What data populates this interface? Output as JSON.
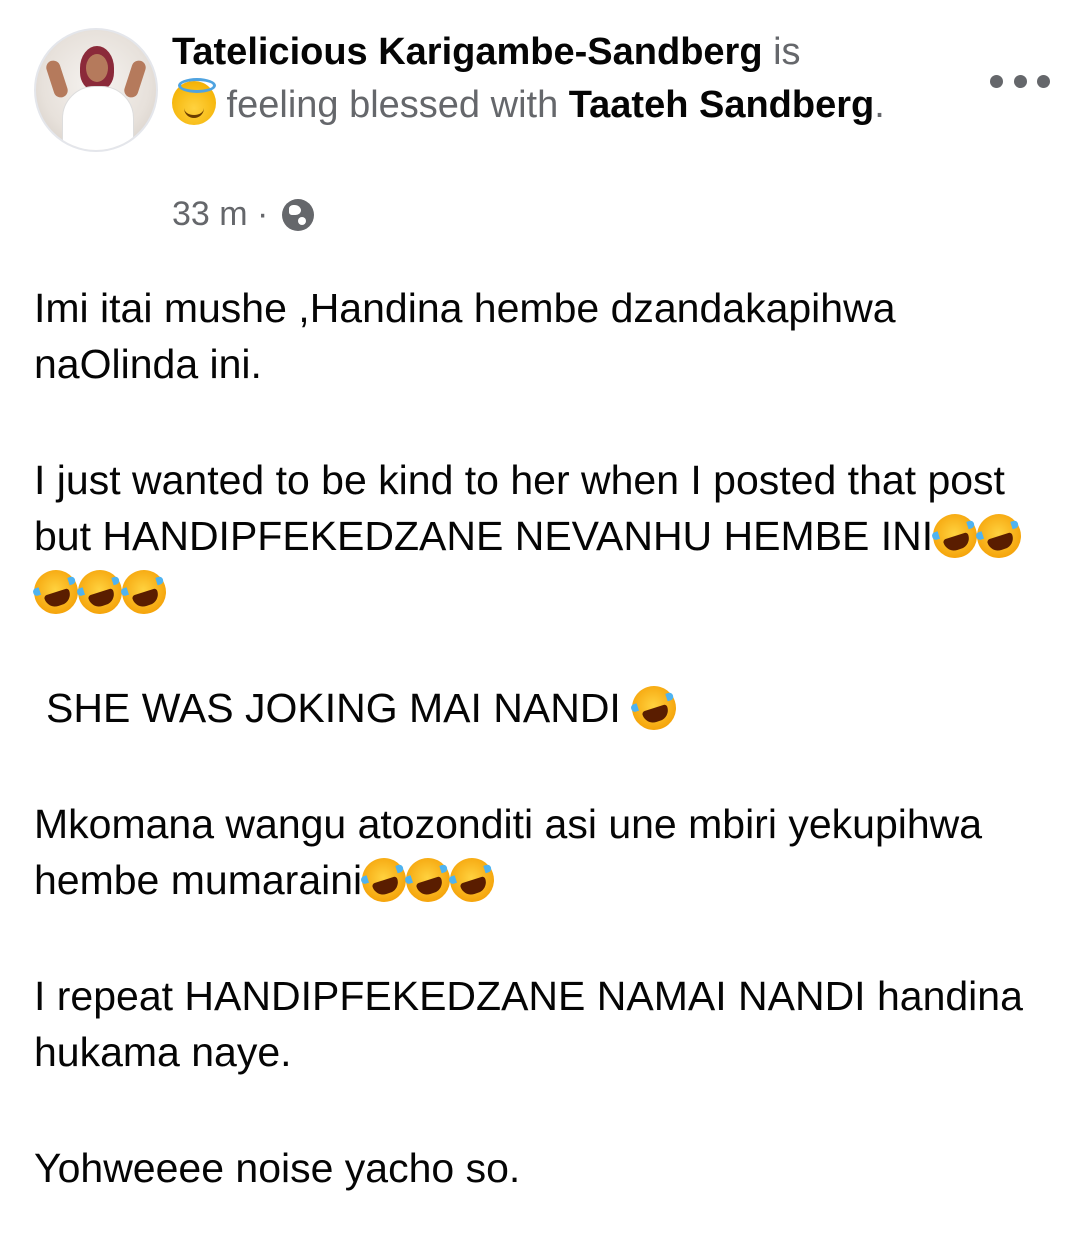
{
  "post": {
    "author": "Tatelicious Karigambe-Sandberg",
    "verb": " is",
    "feeling_text": " feeling blessed with ",
    "tagged": "Taateh Sandberg",
    "period": ".",
    "feeling_emoji": "smiling-face-with-halo-emoji",
    "time": "33 m · ",
    "privacy_icon": "globe-icon"
  },
  "body": {
    "p1": "Imi itai mushe ,Handina hembe dzandakapihwa naOlinda ini.",
    "p2": "I just wanted to be kind to her when I posted that post but HANDIPFEKEDZANE NEVANHU HEMBE INI",
    "p3": "SHE WAS JOKING MAI NANDI ",
    "p4": "Mkomana wangu atozonditi asi une mbiri yekupihwa hembe mumaraini",
    "p5": "I repeat HANDIPFEKEDZANE NAMAI NANDI handina hukama naye.",
    "p6": "Yohweeee noise yacho so."
  },
  "emoji": {
    "laughing": "rolling-on-floor-laughing-emoji"
  }
}
